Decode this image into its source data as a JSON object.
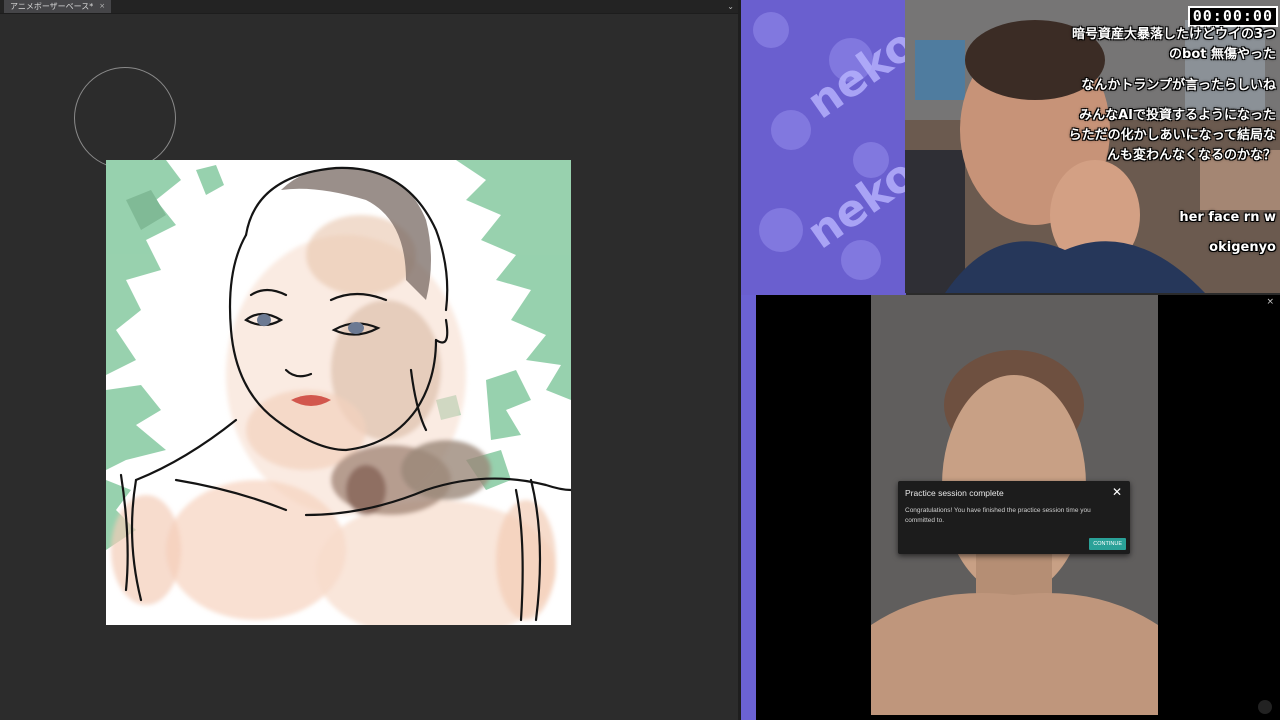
{
  "art_app": {
    "tab_label": "アニメボーザーベース*",
    "tab_close": "×",
    "tab_menu": "⌄"
  },
  "stream": {
    "timer": "00:00:00",
    "pattern_text": "neko",
    "chat": [
      {
        "line1": "暗号資産大暴落したけどウイの3つ",
        "line2": "のbot 無傷やった"
      },
      {
        "line1": "なんかトランプが言ったらしいね"
      },
      {
        "line1": "みんなAIで投資するようになった",
        "line2": "らただの化かしあいになって結局な",
        "line3": "んも変わんなくなるのかな？"
      },
      {
        "line1": "her face rn w"
      },
      {
        "line1": "okigenyo"
      }
    ]
  },
  "practice": {
    "close_label": "×",
    "modal": {
      "title": "Practice session complete",
      "close": "✕",
      "message": "Congratulations! You have finished the practice session time you committed to.",
      "button": "CONTINUE"
    }
  },
  "colors": {
    "leaf_green": "#86c9a0",
    "skin": "#f1c7ac",
    "modal_accent": "#2aa198",
    "pattern_purple": "#6a5fcf"
  }
}
